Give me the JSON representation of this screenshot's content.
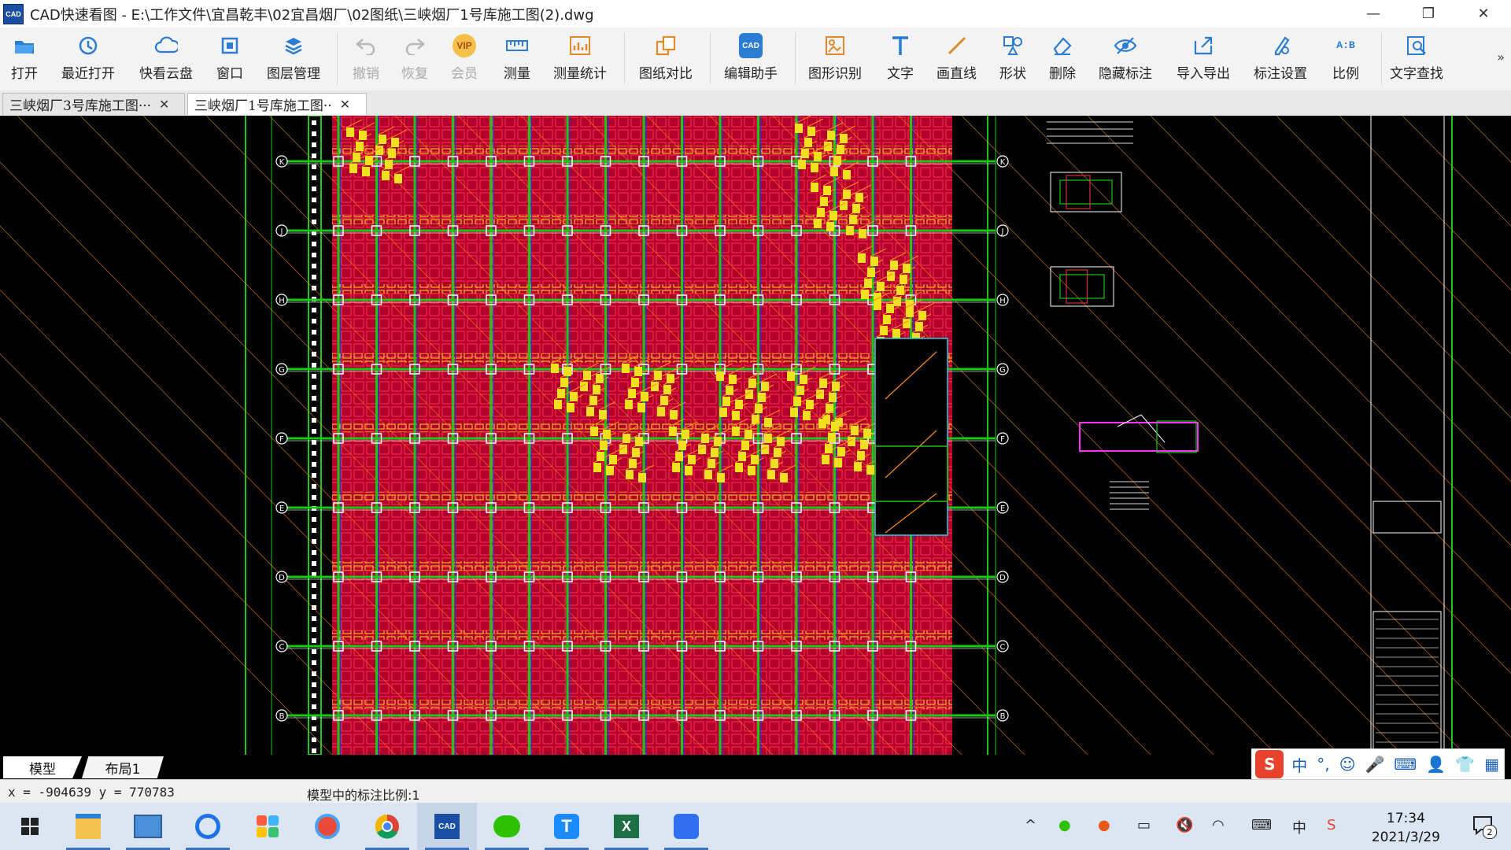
{
  "window": {
    "app_icon_text": "CAD",
    "title": "CAD快速看图 - E:\\工作文件\\宜昌乾丰\\02宜昌烟厂\\02图纸\\三峡烟厂1号库施工图(2).dwg",
    "minimize": "—",
    "maximize": "❐",
    "close": "✕"
  },
  "toolbar": {
    "items": [
      {
        "label": "打开",
        "icon": "folder-icon"
      },
      {
        "label": "最近打开",
        "icon": "history-icon"
      },
      {
        "label": "快看云盘",
        "icon": "cloud-icon"
      },
      {
        "label": "窗口",
        "icon": "window-icon"
      },
      {
        "label": "图层管理",
        "icon": "layers-icon"
      },
      {
        "label": "撤销",
        "icon": "undo-icon"
      },
      {
        "label": "恢复",
        "icon": "redo-icon"
      },
      {
        "label": "会员",
        "icon": "vip-icon"
      },
      {
        "label": "测量",
        "icon": "ruler-icon"
      },
      {
        "label": "测量统计",
        "icon": "measure-stats-icon"
      },
      {
        "label": "图纸对比",
        "icon": "compare-icon"
      },
      {
        "label": "编辑助手",
        "icon": "edit-assistant-icon"
      },
      {
        "label": "图形识别",
        "icon": "shape-recognize-icon"
      },
      {
        "label": "文字",
        "icon": "text-icon"
      },
      {
        "label": "画直线",
        "icon": "line-icon"
      },
      {
        "label": "形状",
        "icon": "shapes-icon"
      },
      {
        "label": "删除",
        "icon": "eraser-icon"
      },
      {
        "label": "隐藏标注",
        "icon": "hide-annotation-icon"
      },
      {
        "label": "导入导出",
        "icon": "import-export-icon"
      },
      {
        "label": "标注设置",
        "icon": "annotation-settings-icon"
      },
      {
        "label": "比例",
        "icon": "scale-icon"
      },
      {
        "label": "文字查找",
        "icon": "text-search-icon"
      }
    ],
    "vip_text": "VIP",
    "cad_text": "CAD",
    "ab_text": "A:B",
    "more": "»"
  },
  "tabs": [
    {
      "label": "三峡烟厂3号库施工图···",
      "close": "✕"
    },
    {
      "label": "三峡烟厂1号库施工图··",
      "close": "✕"
    }
  ],
  "drawing": {
    "axis_labels": [
      "K",
      "J",
      "H",
      "G",
      "F",
      "E",
      "D",
      "C",
      "B"
    ],
    "colors": {
      "background": "#000000",
      "fill_red": "#b3002a",
      "grid_green": "#19c819",
      "yellow": "#f0e020",
      "orange": "#ff8c1a",
      "magenta": "#ff30ff",
      "cyan": "#20d0e0",
      "white": "#f0f0f0"
    }
  },
  "layout_tabs": [
    "模型",
    "布局1"
  ],
  "ime": {
    "cn": "中",
    "punct": "°,"
  },
  "status": {
    "coords": "x = -904639  y = 770783",
    "scale_text": "模型中的标注比例:1"
  },
  "taskbar": {
    "apps": [
      "file-explorer-icon",
      "control-panel-icon",
      "browser-icon",
      "app-grid-icon",
      "360-browser-icon",
      "chrome-icon",
      "cad-viewer-icon",
      "wechat-icon",
      "t-app-icon",
      "excel-icon",
      "feishu-icon"
    ],
    "time": "17:34",
    "date": "2021/3/29",
    "notification_count": "2",
    "ime_cn": "中"
  }
}
